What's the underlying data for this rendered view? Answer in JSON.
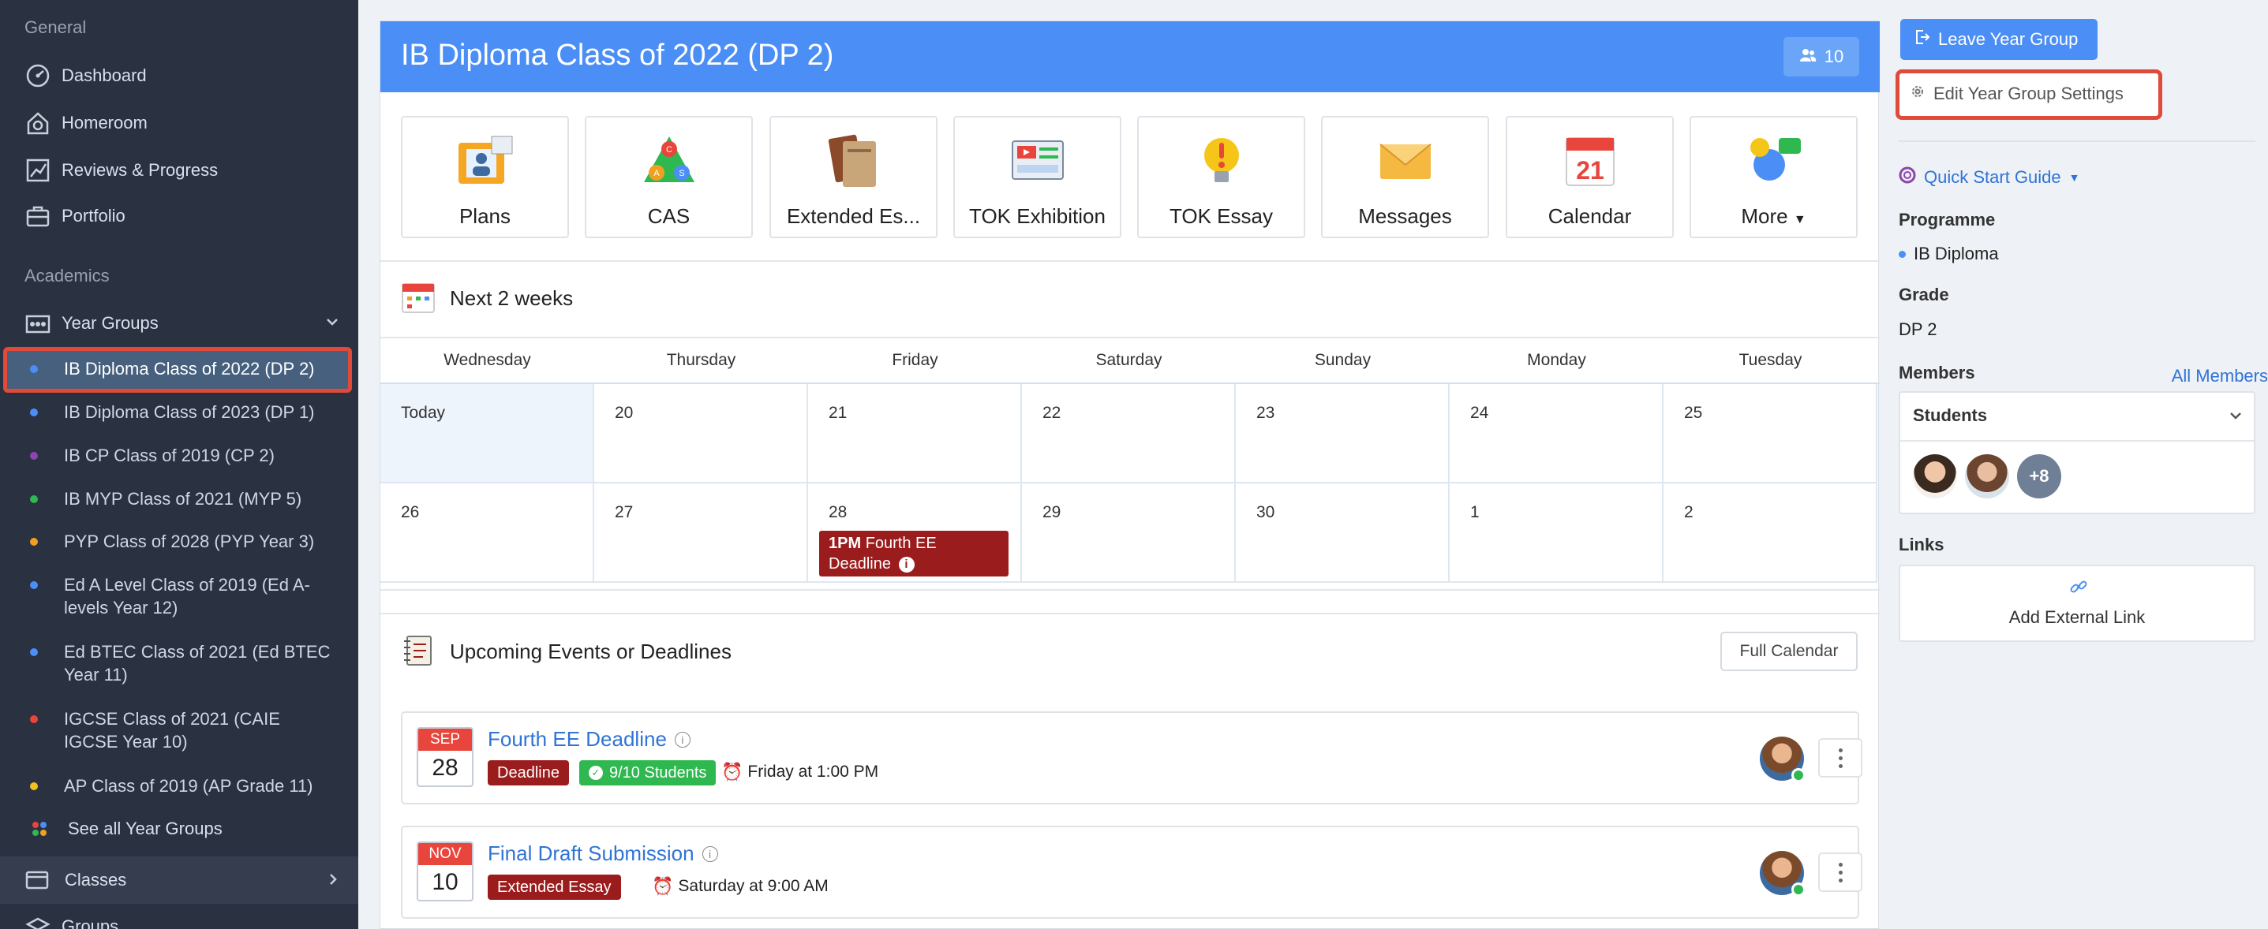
{
  "sidebar": {
    "general_label": "General",
    "academics_label": "Academics",
    "nav": {
      "dashboard": "Dashboard",
      "homeroom": "Homeroom",
      "reviews": "Reviews & Progress",
      "portfolio": "Portfolio",
      "year_groups": "Year Groups",
      "classes": "Classes",
      "groups": "Groups"
    },
    "year_groups": [
      {
        "label": "IB Diploma Class of 2022 (DP 2)",
        "dot": "#4a8ef6"
      },
      {
        "label": "IB Diploma Class of 2023 (DP 1)",
        "dot": "#4a8ef6"
      },
      {
        "label": "IB CP Class of 2019 (CP 2)",
        "dot": "#8e44ad"
      },
      {
        "label": "IB MYP Class of 2021 (MYP 5)",
        "dot": "#2fb84f"
      },
      {
        "label": "PYP Class of 2028 (PYP Year 3)",
        "dot": "#f0a020"
      },
      {
        "label": "Ed A Level Class of 2019 (Ed A-levels Year 12)",
        "dot": "#4a8ef6"
      },
      {
        "label": "Ed BTEC Class of 2021 (Ed BTEC Year 11)",
        "dot": "#4a8ef6"
      },
      {
        "label": "IGCSE Class of 2021 (CAIE IGCSE Year 10)",
        "dot": "#e8453c"
      },
      {
        "label": "AP Class of 2019 (AP Grade 11)",
        "dot": "#f0c020"
      }
    ],
    "see_all": "See all Year Groups"
  },
  "header": {
    "title": "IB Diploma Class of 2022 (DP 2)",
    "member_count": "10"
  },
  "tools": [
    {
      "label": "Plans",
      "icon": "plans-icon"
    },
    {
      "label": "CAS",
      "icon": "cas-icon"
    },
    {
      "label": "Extended Es...",
      "icon": "extended-essay-icon"
    },
    {
      "label": "TOK Exhibition",
      "icon": "tok-exhibition-icon"
    },
    {
      "label": "TOK Essay",
      "icon": "tok-essay-icon"
    },
    {
      "label": "Messages",
      "icon": "messages-icon"
    },
    {
      "label": "Calendar",
      "icon": "calendar-icon"
    },
    {
      "label": "More",
      "icon": "more-icon"
    }
  ],
  "calendar": {
    "title": "Next 2 weeks",
    "days": [
      "Wednesday",
      "Thursday",
      "Friday",
      "Saturday",
      "Sunday",
      "Monday",
      "Tuesday"
    ],
    "week1": [
      "Today",
      "20",
      "21",
      "22",
      "23",
      "24",
      "25"
    ],
    "week2": [
      "26",
      "27",
      "28",
      "29",
      "30",
      "1",
      "2"
    ],
    "calendar_icon_day": "21",
    "event": {
      "time": "1PM",
      "title": "Fourth EE",
      "title2": "Deadline"
    }
  },
  "upcoming": {
    "title": "Upcoming Events or Deadlines",
    "full_calendar": "Full Calendar",
    "events": [
      {
        "month": "SEP",
        "day": "28",
        "title": "Fourth EE Deadline",
        "tag": "Deadline",
        "students": "9/10 Students",
        "when": "Friday at 1:00 PM"
      },
      {
        "month": "NOV",
        "day": "10",
        "title": "Final Draft Submission",
        "tag": "Extended Essay",
        "when": "Saturday at 9:00 AM"
      }
    ]
  },
  "right": {
    "leave": "Leave Year Group",
    "edit": "Edit Year Group Settings",
    "quick_start": "Quick Start Guide",
    "programme_label": "Programme",
    "programme": "IB Diploma",
    "grade_label": "Grade",
    "grade": "DP 2",
    "members_label": "Members",
    "all_members": "All Members",
    "students": "Students",
    "more_count": "+8",
    "links_label": "Links",
    "add_link": "Add External Link"
  },
  "colors": {
    "accent": "#4a8ef6",
    "sidebar_bg": "#2a3141",
    "highlight": "#e04a3a",
    "deadline": "#9b1c1c",
    "success": "#2fb84f"
  }
}
